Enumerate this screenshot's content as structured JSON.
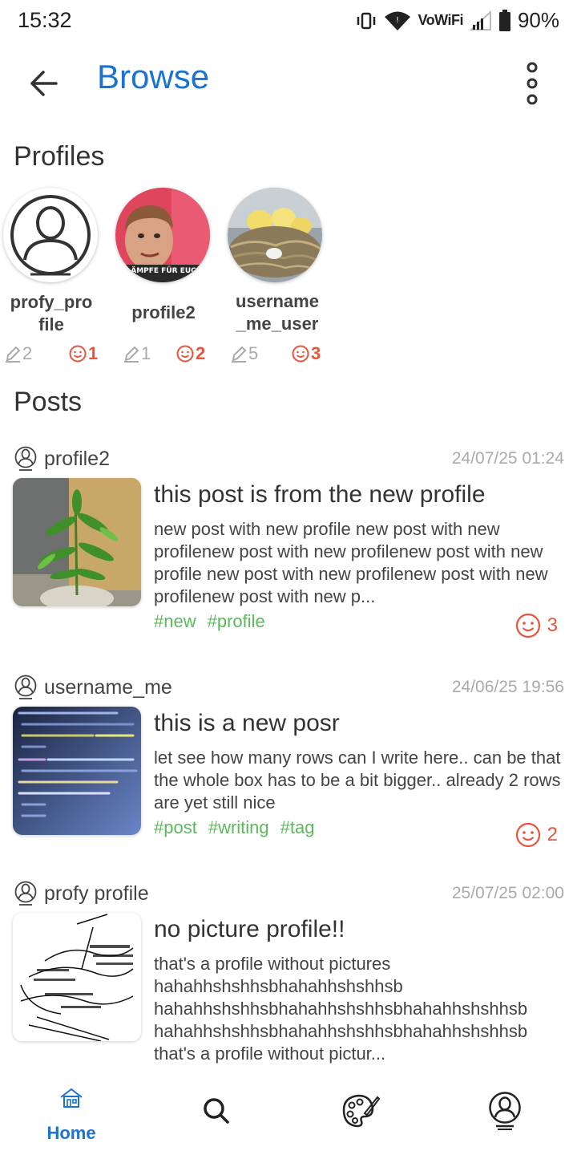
{
  "status_bar": {
    "time": "15:32",
    "network": "VoWiFi",
    "battery": "90%"
  },
  "app_bar": {
    "title": "Browse"
  },
  "sections": {
    "profiles": "Profiles",
    "posts": "Posts"
  },
  "profiles": [
    {
      "name": "profy_pro\nfile",
      "posts": "2",
      "likes": "1",
      "avatar": "default-user-icon"
    },
    {
      "name": "profile2",
      "posts": "1",
      "likes": "2",
      "avatar": "portrait-photo"
    },
    {
      "name": "username\n_me_user",
      "posts": "5",
      "likes": "3",
      "avatar": "chicks-nest-photo"
    }
  ],
  "posts": [
    {
      "author": "profile2",
      "date": "24/07/25 01:24",
      "title": "this post is from the new profile",
      "body": "new post with new profile new post with new profilenew post with new profilenew post with new profile new post with new profilenew post with new profilenew post with new p...",
      "tags": [
        "#new",
        "#profile"
      ],
      "likes": "3"
    },
    {
      "author": "username_me",
      "date": "24/06/25 19:56",
      "title": "this is a new posr",
      "body": "let see how many rows can I write here.. can be that the whole box has to be a bit bigger.. already 2 rows are yet still nice",
      "tags": [
        "#post",
        "#writing",
        "#tag"
      ],
      "likes": "2"
    },
    {
      "author": "profy profile",
      "date": "25/07/25 02:00",
      "title": "no picture profile!!",
      "body": "that's a profile without pictures\nhahahhshshhsbhahahhshshhsb\nhahahhshshhsbhahahhshshhsbhahahhshshhsb\nhahahhshshhsbhahahhshshhsbhahahhshshhsb\nthat's a profile without pictur...",
      "tags": [],
      "likes": ""
    }
  ],
  "bottom_nav": {
    "home_label": "Home"
  },
  "colors": {
    "accent": "#1a73d1",
    "like": "#e8543a",
    "tag": "#5cb85c",
    "muted": "#aaaaaa"
  }
}
